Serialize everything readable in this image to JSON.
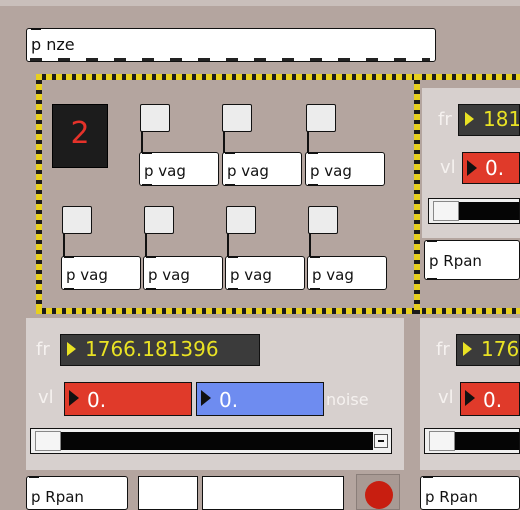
{
  "main_subpatch": {
    "label": "p nze"
  },
  "counter": {
    "value": "2"
  },
  "vag_label": "p vag",
  "rpan_label": "p Rpan",
  "voice_main": {
    "fr_label": "fr",
    "fr_value": "1766.181396",
    "vl_label": "vl",
    "vl_value": "0.",
    "noise_value": "0.",
    "noise_label": "noise"
  },
  "voice_right_top": {
    "fr_label": "fr",
    "fr_value": "181",
    "vl_label": "vl",
    "vl_value": "0."
  },
  "voice_right_bottom": {
    "fr_label": "fr",
    "fr_value": "176",
    "vl_label": "vl",
    "vl_value": "0."
  },
  "colors": {
    "background": "#b4a59f",
    "panel": "#d7d0ce",
    "number_text": "#e9e224",
    "vl_red": "#e03a2a",
    "noise_blue": "#6e8cf0",
    "hazard_yellow": "#e7cf1f",
    "led_red": "#e5322a",
    "record_red": "#c81e10"
  },
  "icons": {
    "inlet_triangle": "play-triangle",
    "record_button": "red-circle"
  }
}
